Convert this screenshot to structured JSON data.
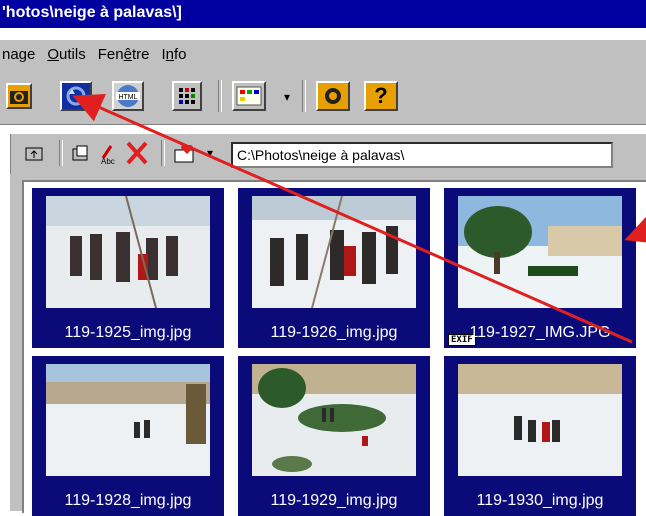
{
  "window": {
    "title": "'hotos\\neige à palavas\\]"
  },
  "menu": [
    {
      "label": "nage"
    },
    {
      "label": "Outils"
    },
    {
      "label": "Fenêtre"
    },
    {
      "label": "Info"
    }
  ],
  "toolbar": {
    "buttons": [
      {
        "name": "camera-icon"
      },
      {
        "name": "slideshow-icon"
      },
      {
        "name": "html-icon",
        "label": "HTML"
      },
      {
        "name": "grid-icon"
      },
      {
        "name": "palette-icon"
      },
      {
        "name": "settings-icon"
      },
      {
        "name": "help-icon",
        "label": "?"
      }
    ]
  },
  "address": {
    "path": "C:\\Photos\\neige à palavas\\"
  },
  "thumbnails": [
    {
      "caption": "119-1925_img.jpg"
    },
    {
      "caption": "119-1926_img.jpg"
    },
    {
      "caption": "119-1927_IMG.JPG",
      "badge": "EXIF"
    },
    {
      "caption": "119-1928_img.jpg"
    },
    {
      "caption": "119-1929_img.jpg"
    },
    {
      "caption": "119-1930_img.jpg"
    }
  ],
  "colors": {
    "title_bar": "#0000a0",
    "thumb_bg": "#0a0a78",
    "arrow": "#e02020"
  }
}
